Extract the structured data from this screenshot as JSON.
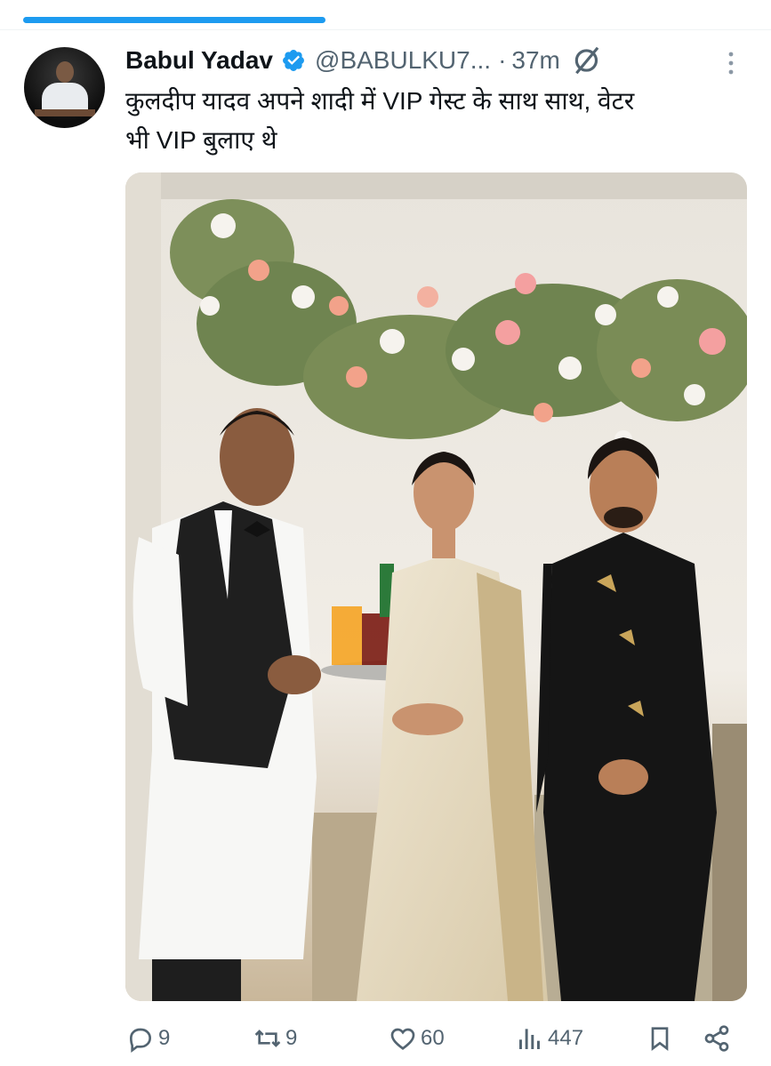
{
  "tweet": {
    "author_name": "Babul Yadav",
    "handle": "@BABULKU7...",
    "separator": "·",
    "time": "37m",
    "text_line1": "कुलदीप यादव अपने शादी में VIP गेस्ट के साथ साथ, वेटर",
    "text_line2": "भी VIP बुलाए थे"
  },
  "actions": {
    "replies": "9",
    "reposts": "9",
    "likes": "60",
    "views": "447"
  },
  "icons": {
    "verified": "verified-badge-icon",
    "mute": "mute-icon",
    "more": "more-vertical-icon",
    "reply": "reply-icon",
    "repost": "repost-icon",
    "like": "like-icon",
    "views": "views-icon",
    "bookmark": "bookmark-icon",
    "share": "share-icon"
  },
  "colors": {
    "accent": "#1d9bf0",
    "text": "#0f1419",
    "secondary": "#536471"
  }
}
